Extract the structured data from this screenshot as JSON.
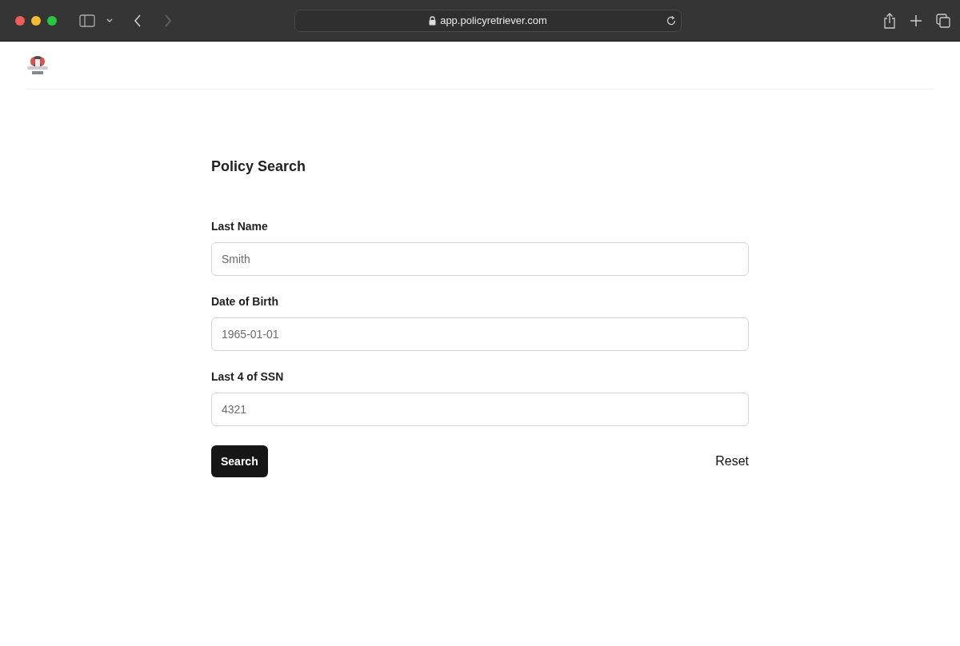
{
  "browser": {
    "address": "app.policyretriever.com"
  },
  "form": {
    "title": "Policy Search",
    "fields": [
      {
        "label": "Last Name",
        "placeholder": "Smith"
      },
      {
        "label": "Date of Birth",
        "placeholder": "1965-01-01"
      },
      {
        "label": "Last 4 of SSN",
        "placeholder": "4321"
      }
    ],
    "submit": "Search",
    "reset": "Reset"
  }
}
